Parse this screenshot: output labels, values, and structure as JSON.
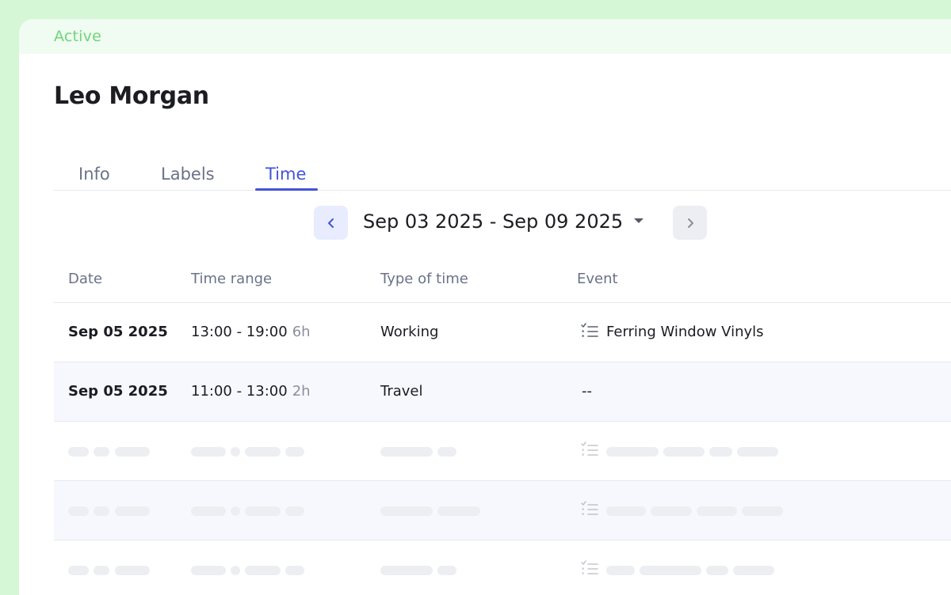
{
  "status": "Active",
  "person": {
    "name": "Leo Morgan"
  },
  "tabs": [
    {
      "label": "Info",
      "active": false
    },
    {
      "label": "Labels",
      "active": false
    },
    {
      "label": "Time",
      "active": true
    }
  ],
  "date_nav": {
    "range": "Sep 03 2025 - Sep 09 2025",
    "prev_icon": "chevron-left-icon",
    "next_icon": "chevron-right-icon"
  },
  "table": {
    "columns": [
      "Date",
      "Time range",
      "Type of time",
      "Event"
    ],
    "rows": [
      {
        "date": "Sep 05 2025",
        "range": "13:00 - 19:00",
        "duration": "6h",
        "type": "Working",
        "event": "Ferring Window Vinyls",
        "event_icon": "checklist-icon"
      },
      {
        "date": "Sep 05 2025",
        "range": "11:00 - 13:00",
        "duration": "2h",
        "type": "Travel",
        "event": "--"
      }
    ]
  },
  "colors": {
    "accent": "#4353d8",
    "status": "#6fd67a",
    "page_bg": "#d5f7d6",
    "alt_row": "#f7f8fd"
  }
}
